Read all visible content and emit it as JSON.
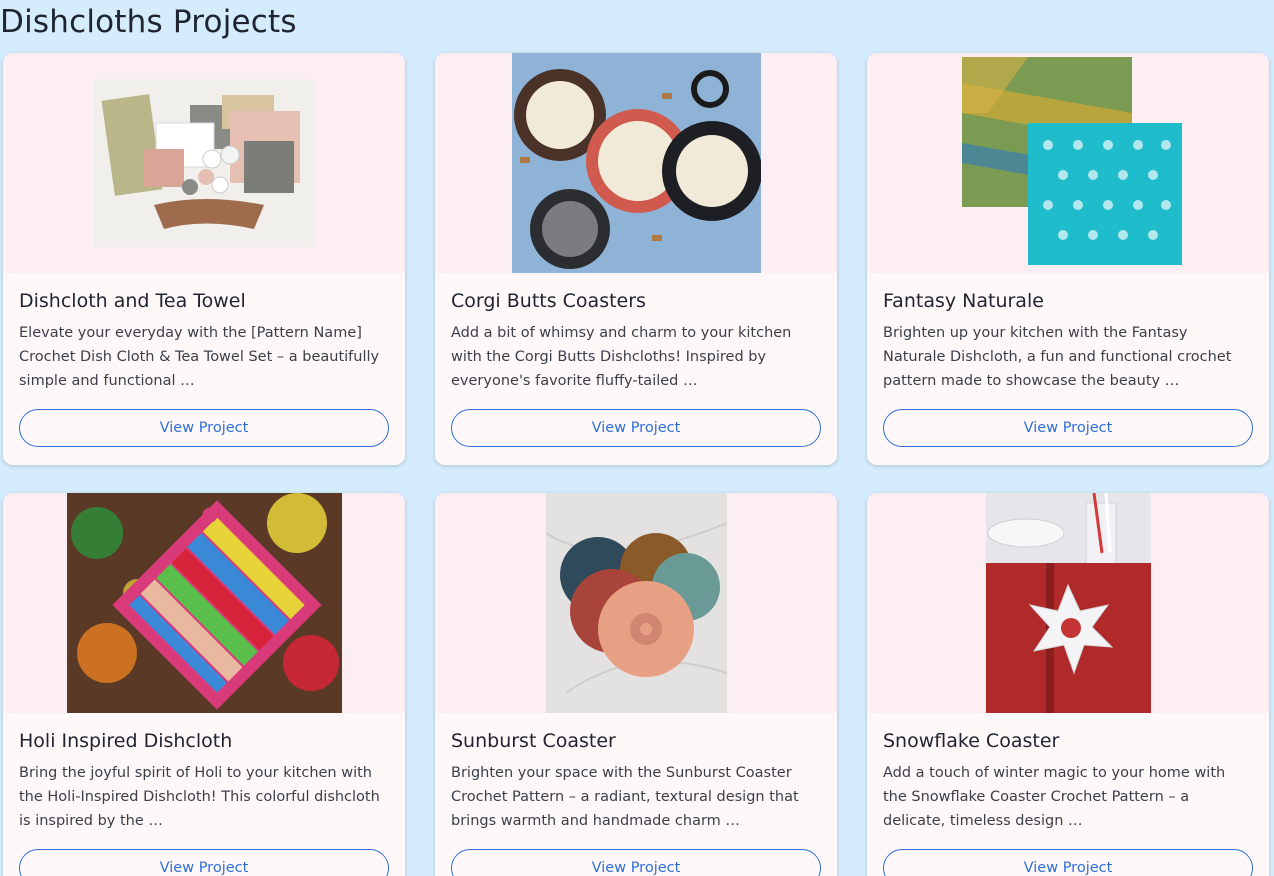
{
  "page": {
    "title": "Dishcloths Projects"
  },
  "colors": {
    "page_background": "#d4ecfb",
    "card_background": "#fff8f9",
    "image_pad": "#fdeef4",
    "accent": "#2f6fdc",
    "text": "#1f2430"
  },
  "cards": [
    {
      "title": "Dishcloth and Tea Towel",
      "description": "Elevate your everyday with the [Pattern Name] Crochet Dish Cloth & Tea Towel Set – a beautifully simple and functional …",
      "button": "View Project",
      "image": "dishcloth-tea-towel-photo"
    },
    {
      "title": "Corgi Butts Coasters",
      "description": "Add a bit of whimsy and charm to your kitchen with the Corgi Butts Dishcloths! Inspired by everyone's favorite fluffy-tailed …",
      "button": "View Project",
      "image": "corgi-coasters-photo"
    },
    {
      "title": "Fantasy Naturale",
      "description": "Brighten up your kitchen with the Fantasy Naturale Dishcloth, a fun and functional crochet pattern made to showcase the beauty …",
      "button": "View Project",
      "image": "fantasy-naturale-photo"
    },
    {
      "title": "Holi Inspired Dishcloth",
      "description": "Bring the joyful spirit of Holi to your kitchen with the Holi-Inspired Dishcloth! This colorful dishcloth is inspired by the …",
      "button": "View Project",
      "image": "holi-dishcloth-photo"
    },
    {
      "title": "Sunburst Coaster",
      "description": "Brighten your space with the Sunburst Coaster Crochet Pattern – a radiant, textural design that brings warmth and handmade charm …",
      "button": "View Project",
      "image": "sunburst-coaster-photo"
    },
    {
      "title": "Snowflake Coaster",
      "description": "Add a touch of winter magic to your home with the Snowflake Coaster Crochet Pattern – a delicate, timeless design …",
      "button": "View Project",
      "image": "snowflake-coaster-photo"
    }
  ]
}
